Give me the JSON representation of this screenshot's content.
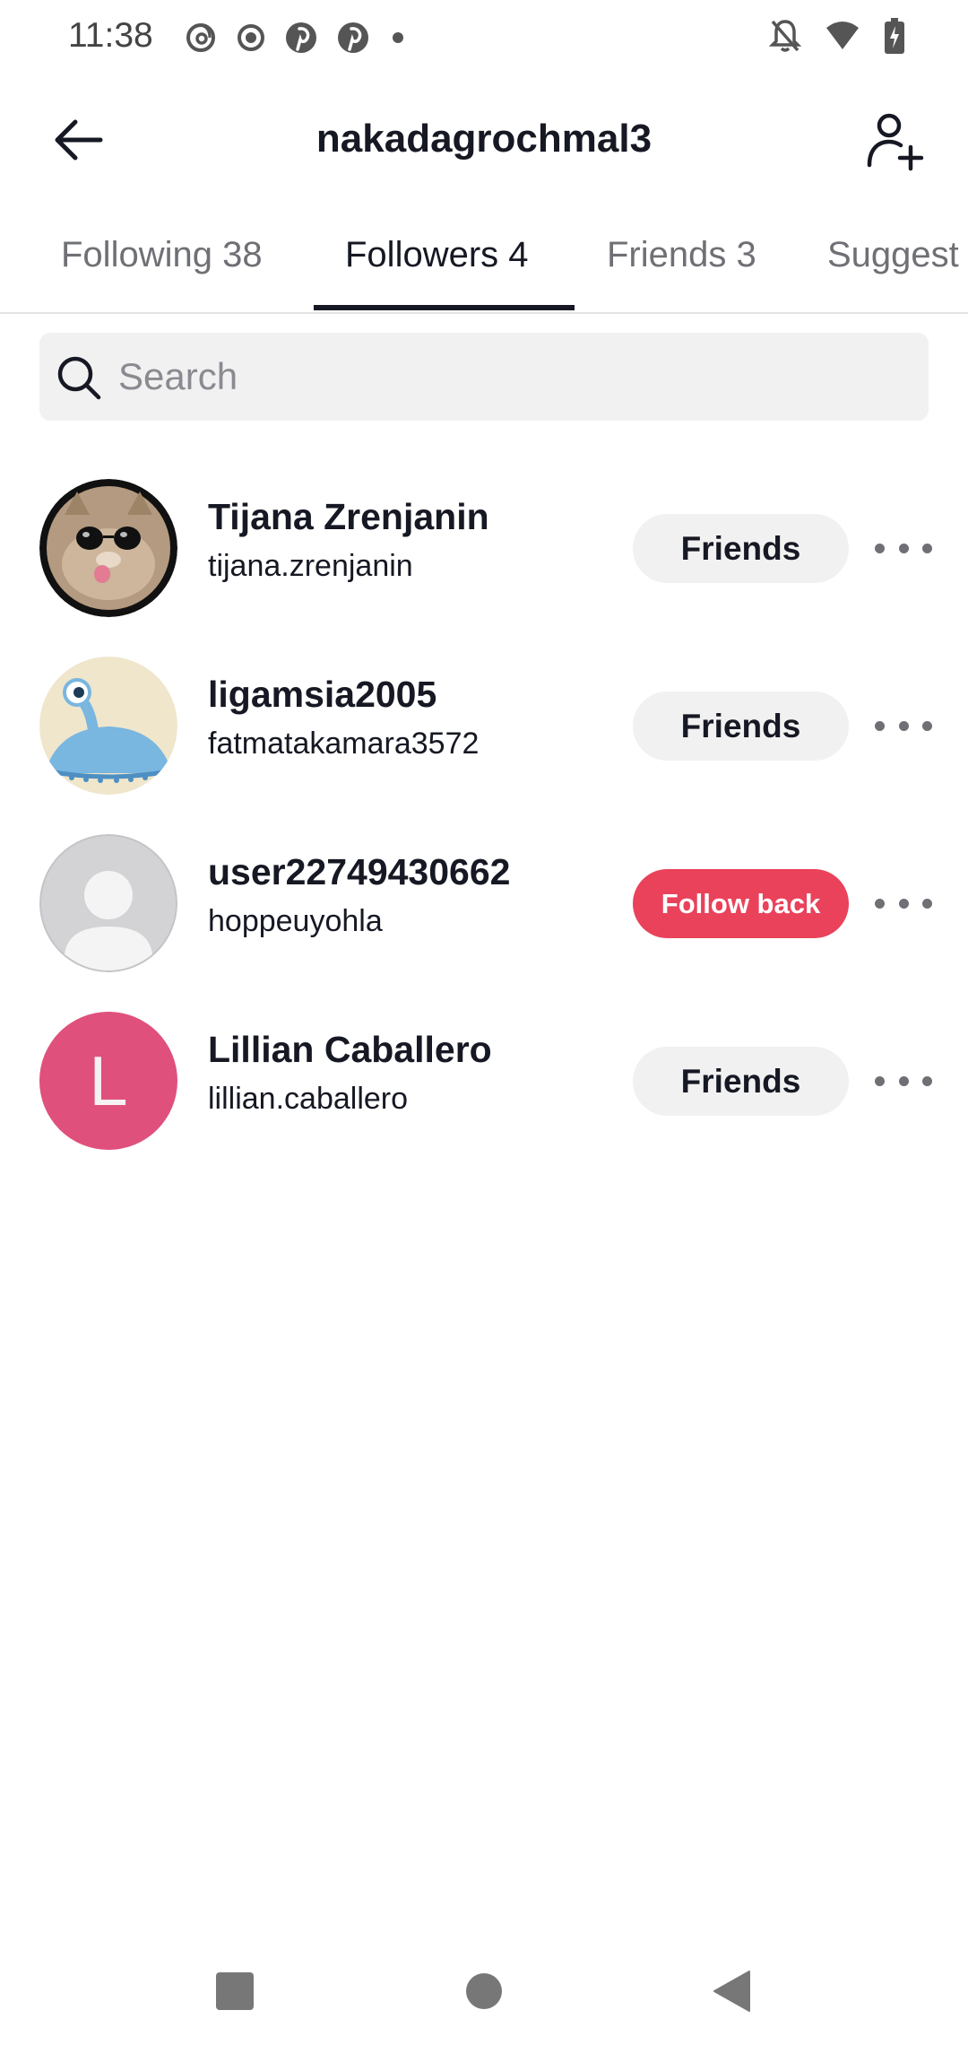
{
  "status_bar": {
    "time": "11:38",
    "left_icons": [
      "threads-icon",
      "record-icon",
      "pinterest-icon",
      "pinterest-icon",
      "dot-icon"
    ],
    "right_icons": [
      "bell-off-icon",
      "wifi-icon",
      "battery-charging-icon"
    ]
  },
  "header": {
    "title": "nakadagrochmal3",
    "back_icon": "arrow-left-icon",
    "add_icon": "add-person-icon"
  },
  "tabs": [
    {
      "label": "Following 38",
      "active": false
    },
    {
      "label": "Followers 4",
      "active": true
    },
    {
      "label": "Friends 3",
      "active": false
    },
    {
      "label": "Suggest",
      "active": false
    }
  ],
  "search": {
    "placeholder": "Search",
    "value": ""
  },
  "users": [
    {
      "name": "Tijana Zrenjanin",
      "handle": "tijana.zrenjanin",
      "action": "Friends",
      "avatar": "cat-with-sunglasses-photo"
    },
    {
      "name": "ligamsia2005",
      "handle": "fatmatakamara3572",
      "action": "Friends",
      "avatar": "blue-alien-cartoon"
    },
    {
      "name": "user22749430662",
      "handle": "hoppeuyohla",
      "action": "Follow back",
      "avatar": "default-person-placeholder"
    },
    {
      "name": "Lillian Caballero",
      "handle": "lillian.caballero",
      "action": "Friends",
      "avatar": "letter-avatar",
      "avatar_letter": "L"
    }
  ],
  "colors": {
    "accent": "#e9425a",
    "text": "#161823",
    "muted": "#6f7075",
    "button_bg": "#f1f1f2",
    "letter_avatar_bg": "#e0507c"
  },
  "nav_bar": {
    "buttons": [
      "recents-square-icon",
      "home-circle-icon",
      "back-triangle-icon"
    ]
  }
}
